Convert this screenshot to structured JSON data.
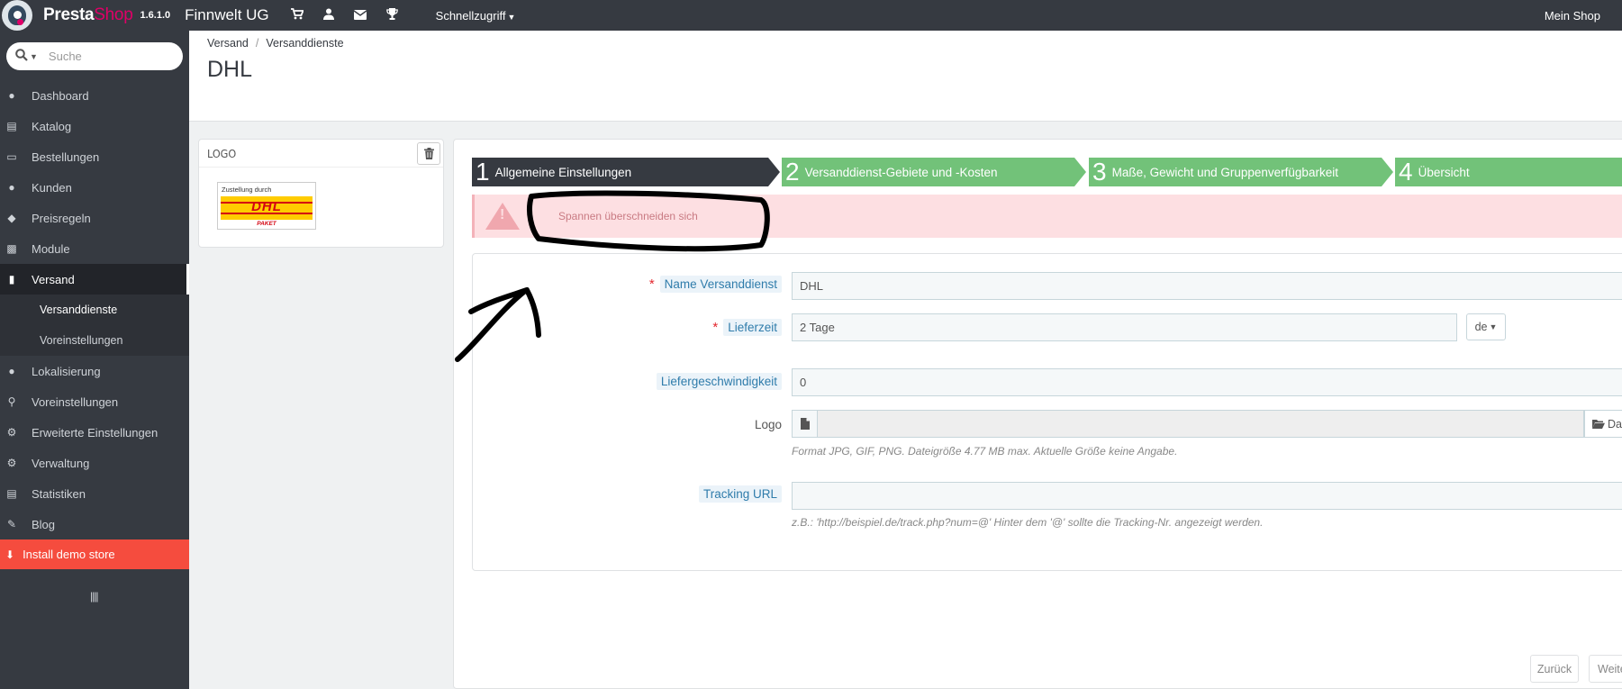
{
  "topbar": {
    "brand_part1": "Presta",
    "brand_part2": "Shop",
    "version": "1.6.1.0",
    "shop_name": "Finnwelt UG",
    "icons": [
      "cart-icon",
      "user-icon",
      "envelope-icon",
      "trophy-icon"
    ],
    "quick_access": "Schnellzugriff",
    "my_shop": "Mein Shop"
  },
  "sidebar": {
    "search_placeholder": "Suche",
    "items": [
      {
        "label": "Dashboard",
        "icon": "dashboard-icon"
      },
      {
        "label": "Katalog",
        "icon": "book-icon"
      },
      {
        "label": "Bestellungen",
        "icon": "credit-card-icon"
      },
      {
        "label": "Kunden",
        "icon": "users-icon"
      },
      {
        "label": "Preisregeln",
        "icon": "tags-icon"
      },
      {
        "label": "Module",
        "icon": "puzzle-icon"
      },
      {
        "label": "Versand",
        "icon": "truck-icon",
        "active": true
      },
      {
        "label": "Lokalisierung",
        "icon": "globe-icon"
      },
      {
        "label": "Voreinstellungen",
        "icon": "wrench-icon"
      },
      {
        "label": "Erweiterte Einstellungen",
        "icon": "cogs-icon"
      },
      {
        "label": "Verwaltung",
        "icon": "gear-icon"
      },
      {
        "label": "Statistiken",
        "icon": "bar-chart-icon"
      },
      {
        "label": "Blog",
        "icon": "edit-icon"
      }
    ],
    "subitems": [
      "Versanddienste",
      "Voreinstellungen"
    ],
    "install_demo": "Install demo store"
  },
  "header": {
    "breadcrumb": [
      "Versand",
      "Versanddienste"
    ],
    "title": "DHL"
  },
  "logo_panel": {
    "title": "LOGO",
    "image_caption": "Zustellung durch",
    "image_brand": "DHL",
    "image_sub": "PAKET"
  },
  "wizard": {
    "steps": [
      {
        "num": "1",
        "label": "Allgemeine Einstellungen",
        "state": "current"
      },
      {
        "num": "2",
        "label": "Versanddienst-Gebiete und -Kosten",
        "state": "done"
      },
      {
        "num": "3",
        "label": "Maße, Gewicht und Gruppenverfügbarkeit",
        "state": "done"
      },
      {
        "num": "4",
        "label": "Übersicht",
        "state": "done"
      }
    ]
  },
  "alert": {
    "message": "Spannen überschneiden sich"
  },
  "form": {
    "name_label": "Name Versanddienst",
    "name_value": "DHL",
    "delivery_label": "Lieferzeit",
    "delivery_value": "2 Tage",
    "lang": "de",
    "speed_label": "Liefergeschwindigkeit",
    "speed_value": "0",
    "logo_label": "Logo",
    "file_button": "Datei",
    "logo_help": "Format JPG, GIF, PNG. Dateigröße 4.77 MB max. Aktuelle Größe keine Angabe.",
    "tracking_label": "Tracking URL",
    "tracking_value": "",
    "tracking_help": "z.B.: 'http://beispiel.de/track.php?num=@' Hinter dem '@' sollte die Tracking-Nr. angezeigt werden."
  },
  "footer": {
    "back": "Zurück",
    "next": "Weiter"
  },
  "colors": {
    "sidebar_bg": "#363a41",
    "step_current": "#363a41",
    "step_done": "#72c279",
    "alert_bg": "#fddfe2",
    "install_bg": "#f54c3e",
    "brand_accent": "#df0067"
  }
}
